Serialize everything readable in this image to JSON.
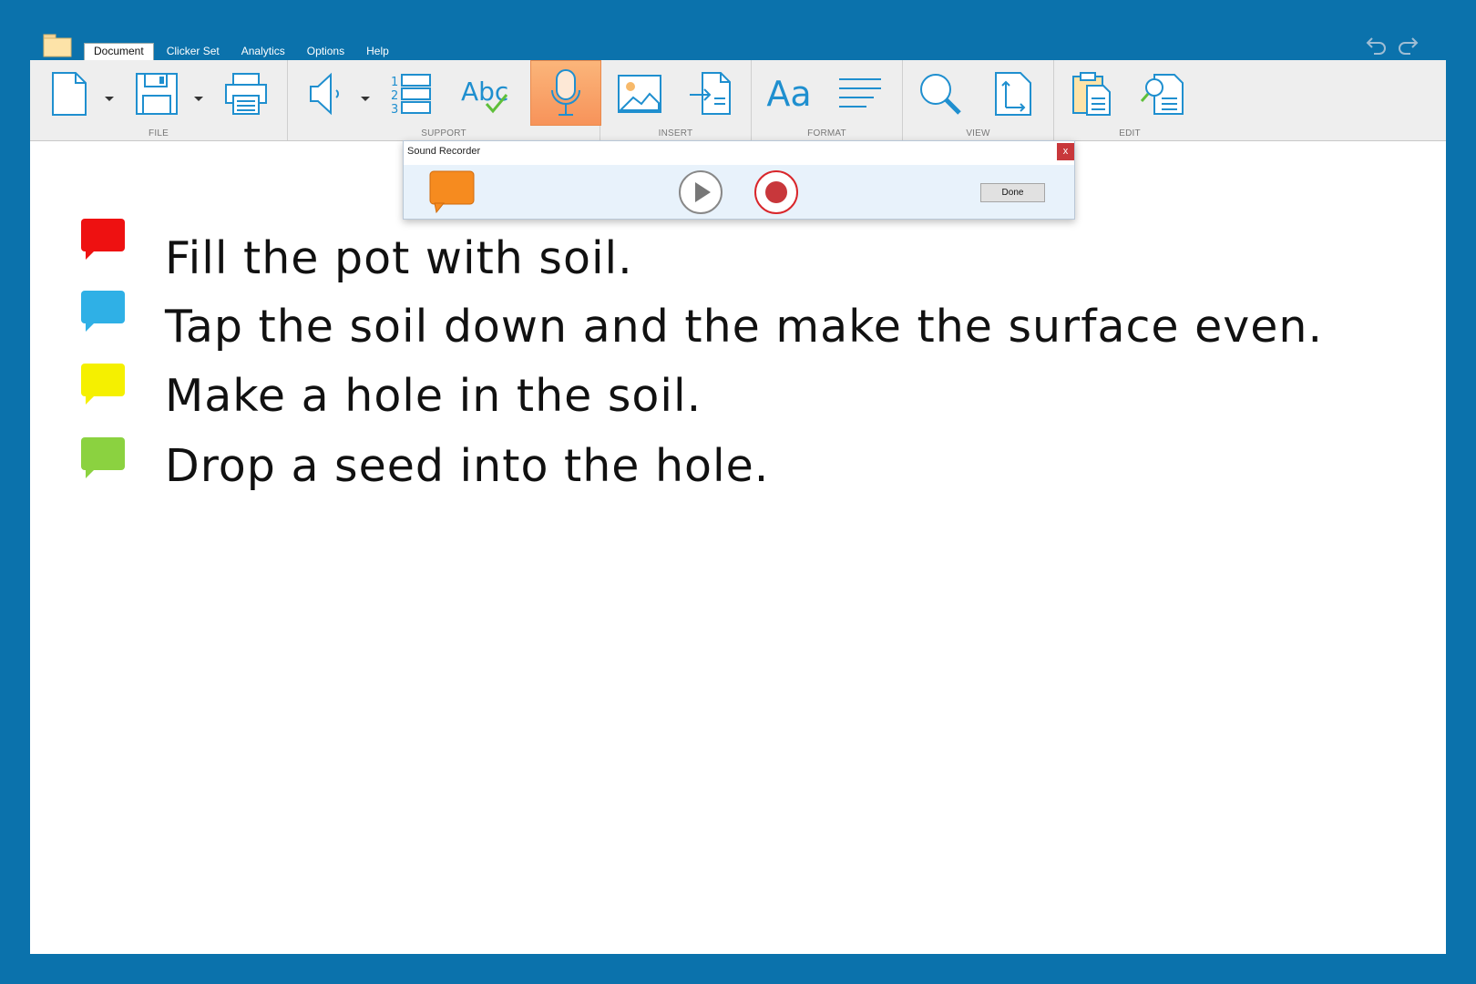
{
  "menu": {
    "tabs": [
      {
        "label": "Document",
        "active": true
      },
      {
        "label": "Clicker Set",
        "active": false
      },
      {
        "label": "Analytics",
        "active": false
      },
      {
        "label": "Options",
        "active": false
      },
      {
        "label": "Help",
        "active": false
      }
    ]
  },
  "ribbon": {
    "groups": {
      "file": "FILE",
      "support": "SUPPORT",
      "insert": "INSERT",
      "format": "FORMAT",
      "view": "VIEW",
      "edit": "EDIT"
    },
    "format_font_icon_text": "Aa",
    "spellcheck_icon_text": "Abc"
  },
  "recorder": {
    "title": "Sound Recorder",
    "close_label": "x",
    "done_label": "Done"
  },
  "document": {
    "lines": [
      {
        "text": "Fill the pot with soil.",
        "bubble_color": "#ee1111"
      },
      {
        "text": "Tap the soil down and the make the surface even.",
        "bubble_color": "#2fb0e6"
      },
      {
        "text": "Make a hole in the soil.",
        "bubble_color": "#f5f000"
      },
      {
        "text": "Drop a seed into the hole.",
        "bubble_color": "#8bd240"
      }
    ]
  },
  "colors": {
    "background": "#0b72ac",
    "icon_blue": "#1f8fcf",
    "active_button": "#f7935a",
    "recorder_bubble": "#f68b1f",
    "record_red": "#c8373b"
  }
}
